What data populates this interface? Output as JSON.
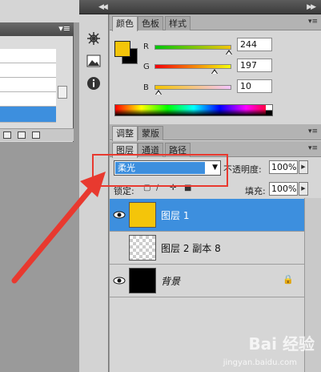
{
  "color_panel": {
    "tabs": [
      "颜色",
      "色板",
      "样式"
    ],
    "channels": [
      {
        "label": "R",
        "value": "244",
        "fraction": 0.957
      },
      {
        "label": "G",
        "value": "197",
        "fraction": 0.773
      },
      {
        "label": "B",
        "value": "10",
        "fraction": 0.039
      }
    ],
    "foreground_color": "#f4c50a",
    "background_color": "#000000"
  },
  "adjust_tabs": [
    "调整",
    "蒙版"
  ],
  "layers_panel": {
    "tabs": [
      "图层",
      "通道",
      "路径"
    ],
    "blend_mode": "柔光",
    "opacity_label": "不透明度:",
    "opacity_value": "100%",
    "lock_label": "锁定:",
    "fill_label": "填充:",
    "fill_value": "100%",
    "layers": [
      {
        "name": "图层 1",
        "selected": true,
        "thumb": "yellow"
      },
      {
        "name": "图层 2 副本 8",
        "selected": false,
        "thumb": "transparent"
      },
      {
        "name": "背景",
        "selected": false,
        "thumb": "black",
        "locked": true
      }
    ]
  },
  "tools": [
    "network-icon",
    "image-icon",
    "info-icon"
  ],
  "watermark": {
    "text": "Bai 经验",
    "url": "jingyan.baidu.com"
  },
  "colors": {
    "accent": "#3d8fde",
    "annotation": "#e8392f",
    "yellow": "#f4c50a"
  }
}
